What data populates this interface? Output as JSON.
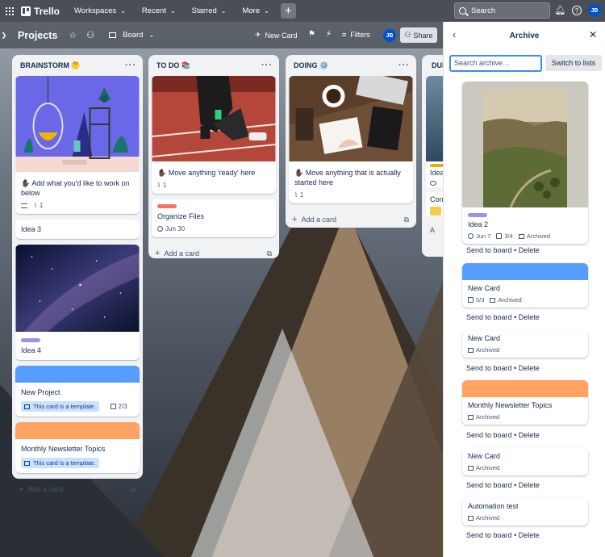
{
  "nav": {
    "logo": "Trello",
    "workspaces": "Workspaces",
    "recent": "Recent",
    "starred": "Starred",
    "more": "More",
    "search_placeholder": "Search",
    "avatar": "JB"
  },
  "board": {
    "title": "Projects",
    "view": "Board",
    "new_card": "New Card",
    "filters": "Filters",
    "share": "Share",
    "avatar": "JB"
  },
  "lists": [
    {
      "title": "BRAINSTORM 🤔",
      "cards": [
        {
          "title": "✋🏿 Add what you'd like to work on below",
          "attachments": "1"
        },
        {
          "title": "Idea 3"
        },
        {
          "title": "Idea 4"
        },
        {
          "title": "New Project",
          "template": "This card is a template.",
          "checklist": "2/3"
        },
        {
          "title": "Monthly Newsletter Topics",
          "template": "This card is a template."
        }
      ],
      "add": "Add a card"
    },
    {
      "title": "TO DO 📚",
      "cards": [
        {
          "title": "✋🏿 Move anything 'ready' here",
          "attachments": "1"
        },
        {
          "title": "Organize Files",
          "due": "Jun 30"
        }
      ],
      "add": "Add a card"
    },
    {
      "title": "DOING ⚙️",
      "cards": [
        {
          "title": "✋🏿 Move anything that is actually started here",
          "attachments": "1"
        }
      ],
      "add": "Add a card"
    },
    {
      "title": "DUI",
      "cards": [
        {
          "title": "Idea"
        },
        {
          "title": "Con"
        }
      ],
      "add": "A"
    }
  ],
  "archive": {
    "title": "Archive",
    "search_placeholder": "Search archive…",
    "switch": "Switch to lists",
    "send_to_board": "Send to board",
    "separator": "•",
    "delete": "Delete",
    "items": [
      {
        "title": "Idea 2",
        "due": "Jun 7",
        "checklist": "3/4",
        "status": "Archived"
      },
      {
        "title": "New Card",
        "checklist": "0/3",
        "status": "Archived"
      },
      {
        "title": "New Card",
        "status": "Archived"
      },
      {
        "title": "Monthly Newsletter Topics",
        "status": "Archived"
      },
      {
        "title": "New Card",
        "status": "Archived"
      },
      {
        "title": "Automation test",
        "status": "Archived"
      }
    ]
  },
  "colors": {
    "blue_cover": "#579dff",
    "orange_cover": "#fea362",
    "purple_label": "#9f8fef",
    "red_label": "#f87168",
    "yellow_label": "#e2b203"
  },
  "icons": [
    "grid-icon",
    "star-icon",
    "people-icon",
    "board-icon",
    "chevron-down-icon",
    "lightning-icon",
    "rocket-icon",
    "filter-icon",
    "bell-icon",
    "help-icon",
    "megaphone-icon",
    "back-icon",
    "close-icon"
  ]
}
